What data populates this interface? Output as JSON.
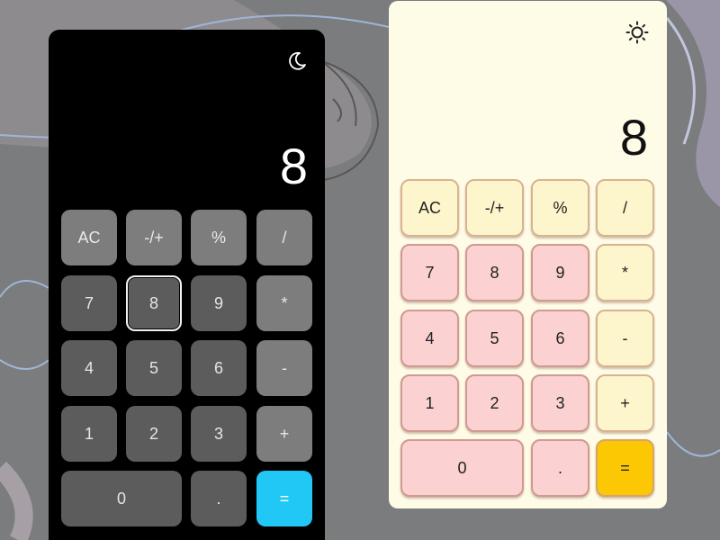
{
  "dark_calculator": {
    "theme_icon": "moon-icon",
    "display": "8",
    "active_key": "8",
    "keys": [
      "AC",
      "-/+",
      "%",
      "/",
      "7",
      "8",
      "9",
      "*",
      "4",
      "5",
      "6",
      "-",
      "1",
      "2",
      "3",
      "+",
      "0",
      ".",
      "="
    ],
    "colors": {
      "background": "#000000",
      "key": "#5c5c5c",
      "function_key": "#7d7d7d",
      "equals": "#22c8f5"
    }
  },
  "light_calculator": {
    "theme_icon": "sun-icon",
    "display": "8",
    "keys": [
      "AC",
      "-/+",
      "%",
      "/",
      "7",
      "8",
      "9",
      "*",
      "4",
      "5",
      "6",
      "-",
      "1",
      "2",
      "3",
      "+",
      "0",
      ".",
      "="
    ],
    "colors": {
      "background": "#fefbe6",
      "digit_key": "#fbd1d2",
      "function_key": "#fdf6cc",
      "equals": "#fcc804"
    }
  }
}
